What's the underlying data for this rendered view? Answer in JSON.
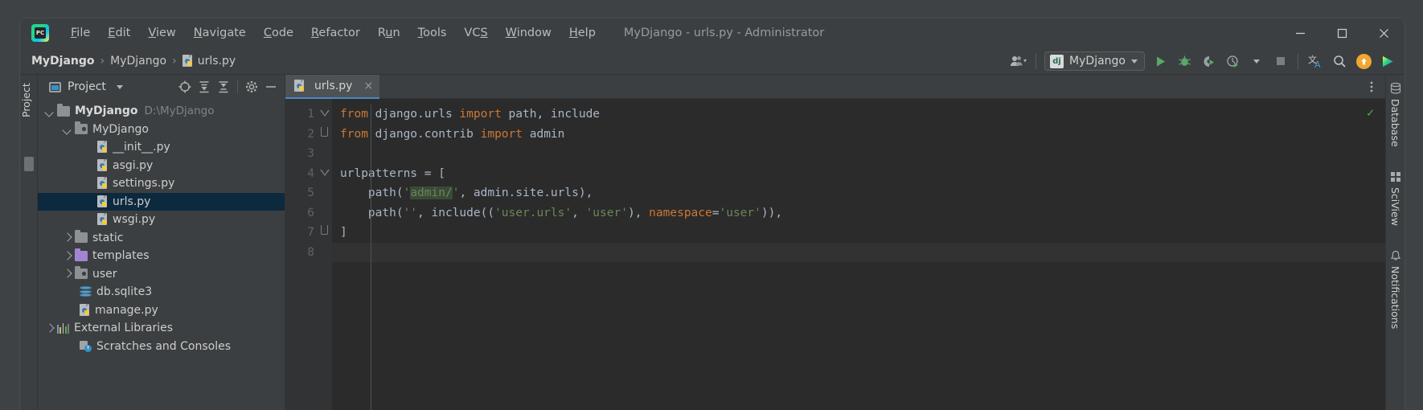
{
  "window": {
    "title": "MyDjango - urls.py - Administrator",
    "controls": {
      "minimize": "minimize-button",
      "maximize": "maximize-button",
      "close": "close-button"
    }
  },
  "menubar": {
    "logo_text": "PC",
    "items": [
      {
        "label": "File",
        "mnemonic": "F"
      },
      {
        "label": "Edit",
        "mnemonic": "E"
      },
      {
        "label": "View",
        "mnemonic": "V"
      },
      {
        "label": "Navigate",
        "mnemonic": "N"
      },
      {
        "label": "Code",
        "mnemonic": "C"
      },
      {
        "label": "Refactor",
        "mnemonic": "R"
      },
      {
        "label": "Run",
        "mnemonic": "u"
      },
      {
        "label": "Tools",
        "mnemonic": "T"
      },
      {
        "label": "VCS",
        "mnemonic": "S"
      },
      {
        "label": "Window",
        "mnemonic": "W"
      },
      {
        "label": "Help",
        "mnemonic": "H"
      }
    ]
  },
  "navbar": {
    "breadcrumbs": [
      {
        "label": "MyDjango",
        "bold": true,
        "icon": null
      },
      {
        "label": "MyDjango",
        "bold": false,
        "icon": null
      },
      {
        "label": "urls.py",
        "bold": false,
        "icon": "python-file-icon"
      }
    ],
    "separator": "›",
    "run_config": {
      "label": "MyDjango",
      "badge": "dj"
    },
    "buttons": [
      {
        "name": "user-account-button",
        "icon": "user-icon"
      },
      {
        "name": "run-button",
        "icon": "play-icon"
      },
      {
        "name": "debug-button",
        "icon": "bug-icon"
      },
      {
        "name": "run-with-coverage-button",
        "icon": "coverage-icon"
      },
      {
        "name": "profile-button",
        "icon": "profiler-icon"
      },
      {
        "name": "stop-button",
        "icon": "stop-icon"
      },
      {
        "name": "translate-button",
        "icon": "translate-icon"
      },
      {
        "name": "search-everywhere-button",
        "icon": "search-icon"
      },
      {
        "name": "update-available-button",
        "icon": "arrow-up-icon"
      },
      {
        "name": "plugin-button",
        "icon": "triangle-icon"
      }
    ]
  },
  "left_stripe": {
    "label": "Project"
  },
  "project_panel": {
    "title": "Project",
    "tools": [
      {
        "name": "select-opened-file-button",
        "icon": "target-icon"
      },
      {
        "name": "expand-all-button",
        "icon": "expand-icon"
      },
      {
        "name": "collapse-all-button",
        "icon": "collapse-icon"
      },
      {
        "name": "settings-button",
        "icon": "gear-icon"
      },
      {
        "name": "hide-button",
        "icon": "minus-icon"
      }
    ],
    "tree": [
      {
        "label": "MyDjango",
        "path": "D:\\MyDjango",
        "indent": 0,
        "arrow": "down",
        "icon": "folder-icon",
        "bold": true,
        "selected": false
      },
      {
        "label": "MyDjango",
        "path": "",
        "indent": 1,
        "arrow": "down",
        "icon": "source-folder-icon",
        "bold": false,
        "selected": false
      },
      {
        "label": "__init__.py",
        "path": "",
        "indent": 2,
        "arrow": "none",
        "icon": "python-file-icon",
        "bold": false,
        "selected": false
      },
      {
        "label": "asgi.py",
        "path": "",
        "indent": 2,
        "arrow": "none",
        "icon": "python-file-icon",
        "bold": false,
        "selected": false
      },
      {
        "label": "settings.py",
        "path": "",
        "indent": 2,
        "arrow": "none",
        "icon": "python-file-icon",
        "bold": false,
        "selected": false
      },
      {
        "label": "urls.py",
        "path": "",
        "indent": 2,
        "arrow": "none",
        "icon": "python-file-icon",
        "bold": false,
        "selected": true
      },
      {
        "label": "wsgi.py",
        "path": "",
        "indent": 2,
        "arrow": "none",
        "icon": "python-file-icon",
        "bold": false,
        "selected": false
      },
      {
        "label": "static",
        "path": "",
        "indent": 1,
        "arrow": "right",
        "icon": "folder-icon",
        "bold": false,
        "selected": false
      },
      {
        "label": "templates",
        "path": "",
        "indent": 1,
        "arrow": "right",
        "icon": "template-folder-icon",
        "bold": false,
        "selected": false
      },
      {
        "label": "user",
        "path": "",
        "indent": 1,
        "arrow": "right",
        "icon": "source-folder-icon",
        "bold": false,
        "selected": false
      },
      {
        "label": "db.sqlite3",
        "path": "",
        "indent": 1,
        "arrow": "none",
        "icon": "database-icon",
        "bold": false,
        "selected": false
      },
      {
        "label": "manage.py",
        "path": "",
        "indent": 1,
        "arrow": "none",
        "icon": "python-file-icon",
        "bold": false,
        "selected": false
      },
      {
        "label": "External Libraries",
        "path": "",
        "indent": 0,
        "arrow": "right",
        "icon": "library-icon",
        "bold": false,
        "selected": false
      },
      {
        "label": "Scratches and Consoles",
        "path": "",
        "indent": 0,
        "arrow": "none",
        "icon": "scratch-icon",
        "bold": false,
        "selected": false
      }
    ]
  },
  "editor": {
    "tab": {
      "label": "urls.py",
      "close": "×",
      "icon": "python-file-icon"
    },
    "inspection_status": "✓",
    "line_numbers": [
      "1",
      "2",
      "3",
      "4",
      "5",
      "6",
      "7",
      "8"
    ],
    "current_line": 8,
    "lines": [
      {
        "n": 1,
        "tokens": [
          {
            "t": "from",
            "c": "kw"
          },
          {
            "t": " django.urls ",
            "c": "txt"
          },
          {
            "t": "import",
            "c": "kw"
          },
          {
            "t": " path, include",
            "c": "txt"
          }
        ]
      },
      {
        "n": 2,
        "tokens": [
          {
            "t": "from",
            "c": "kw"
          },
          {
            "t": " django.contrib ",
            "c": "txt"
          },
          {
            "t": "import",
            "c": "kw"
          },
          {
            "t": " admin",
            "c": "txt"
          }
        ]
      },
      {
        "n": 3,
        "tokens": []
      },
      {
        "n": 4,
        "tokens": [
          {
            "t": "urlpatterns = [",
            "c": "txt"
          }
        ]
      },
      {
        "n": 5,
        "tokens": [
          {
            "t": "    path(",
            "c": "txt"
          },
          {
            "t": "'",
            "c": "str"
          },
          {
            "t": "admin/",
            "c": "strhl"
          },
          {
            "t": "'",
            "c": "str"
          },
          {
            "t": ", admin.site.urls),",
            "c": "txt"
          }
        ]
      },
      {
        "n": 6,
        "tokens": [
          {
            "t": "    path(",
            "c": "txt"
          },
          {
            "t": "''",
            "c": "str"
          },
          {
            "t": ", include((",
            "c": "txt"
          },
          {
            "t": "'user.urls'",
            "c": "str"
          },
          {
            "t": ", ",
            "c": "txt"
          },
          {
            "t": "'user'",
            "c": "str"
          },
          {
            "t": "), ",
            "c": "txt"
          },
          {
            "t": "namespace",
            "c": "namedarg"
          },
          {
            "t": "=",
            "c": "txt"
          },
          {
            "t": "'user'",
            "c": "str"
          },
          {
            "t": ")),",
            "c": "txt"
          }
        ]
      },
      {
        "n": 7,
        "tokens": [
          {
            "t": "]",
            "c": "txt"
          }
        ]
      },
      {
        "n": 8,
        "tokens": []
      }
    ],
    "fold_markers": [
      {
        "line": 1,
        "type": "open-triangle"
      },
      {
        "line": 2,
        "type": "end"
      },
      {
        "line": 4,
        "type": "open-triangle"
      },
      {
        "line": 7,
        "type": "end"
      }
    ]
  },
  "right_stripe": {
    "tabs": [
      "Database",
      "SciView",
      "Notifications"
    ],
    "icons": [
      "database-icon",
      "sciview-icon",
      "notifications-icon"
    ]
  },
  "colors": {
    "accent": "#4a88c7",
    "selection": "#0d293e",
    "keyword": "#cc7832",
    "string": "#6a8759",
    "string_highlight": "#3a4a37",
    "text": "#a9b7c6",
    "editor_bg": "#2b2b2b",
    "panel_bg": "#3c3f41",
    "gutter_bg": "#313335",
    "status_ok": "#4ab34a",
    "update_badge": "#f0a732"
  }
}
